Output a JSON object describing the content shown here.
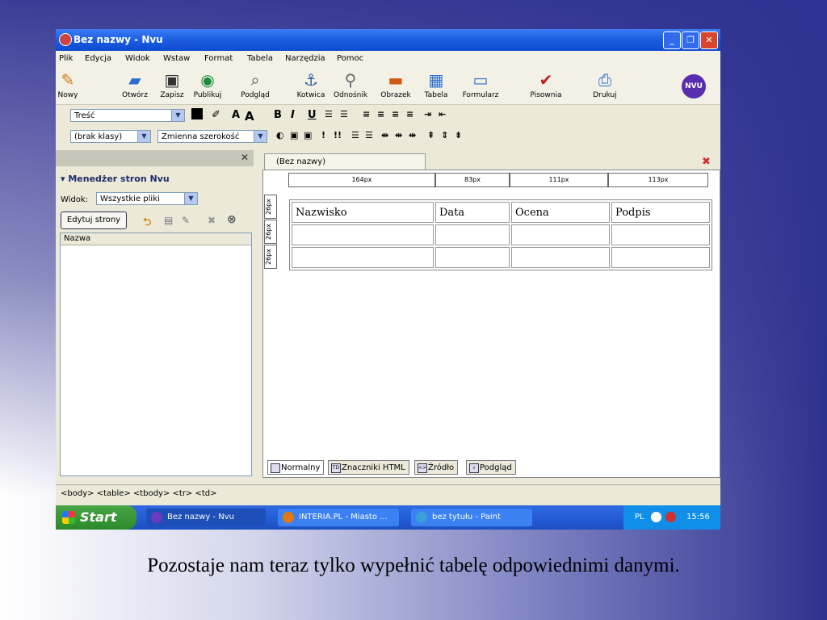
{
  "window": {
    "title": "Bez nazwy - Nvu"
  },
  "menu": [
    "Plik",
    "Edycja",
    "Widok",
    "Wstaw",
    "Format",
    "Tabela",
    "Narzędzia",
    "Pomoc"
  ],
  "toolbar": [
    {
      "label": "Nowy",
      "icon": "new-icon"
    },
    {
      "label": "Otwórz",
      "icon": "open-icon"
    },
    {
      "label": "Zapisz",
      "icon": "save-icon"
    },
    {
      "label": "Publikuj",
      "icon": "publish-icon"
    },
    {
      "label": "Podgląd",
      "icon": "preview-icon"
    },
    {
      "label": "Kotwica",
      "icon": "anchor-icon"
    },
    {
      "label": "Odnośnik",
      "icon": "link-icon"
    },
    {
      "label": "Obrazek",
      "icon": "image-icon"
    },
    {
      "label": "Tabela",
      "icon": "table-icon"
    },
    {
      "label": "Formularz",
      "icon": "form-icon"
    },
    {
      "label": "Pisownia",
      "icon": "spellcheck-icon"
    },
    {
      "label": "Drukuj",
      "icon": "print-icon"
    }
  ],
  "format_toolbar": {
    "paragraph_style": "Treść"
  },
  "format_toolbar2": {
    "class": "(brak klasy)",
    "font": "Zmienna szerokość"
  },
  "sidebar": {
    "title": "Menedżer stron Nvu",
    "view_label": "Widok:",
    "view_value": "Wszystkie pliki",
    "edit_button": "Edytuj strony",
    "column_header": "Nazwa"
  },
  "document": {
    "tab": "(Bez nazwy)",
    "rulers": [
      "164px",
      "83px",
      "111px",
      "113px"
    ],
    "row_rulers": [
      "26px",
      "26px",
      "26px"
    ],
    "table": [
      [
        "Nazwisko",
        "Data",
        "Ocena",
        "Podpis"
      ],
      [
        "",
        "",
        "",
        ""
      ],
      [
        "",
        "",
        "",
        ""
      ]
    ]
  },
  "bottom_tabs": [
    "Normalny",
    "Znaczniki HTML",
    "Źródło",
    "Podgląd"
  ],
  "status": {
    "path": "<body> <table> <tbody> <tr> <td>"
  },
  "taskbar": {
    "start": "Start",
    "tasks": [
      "Bez nazwy - Nvu",
      "INTERIA.PL - Miasto ...",
      "bez tytułu - Paint"
    ],
    "lang": "PL",
    "clock": "15:56"
  },
  "caption": "Pozostaje nam teraz tylko wypełnić tabelę odpowiednimi danymi."
}
